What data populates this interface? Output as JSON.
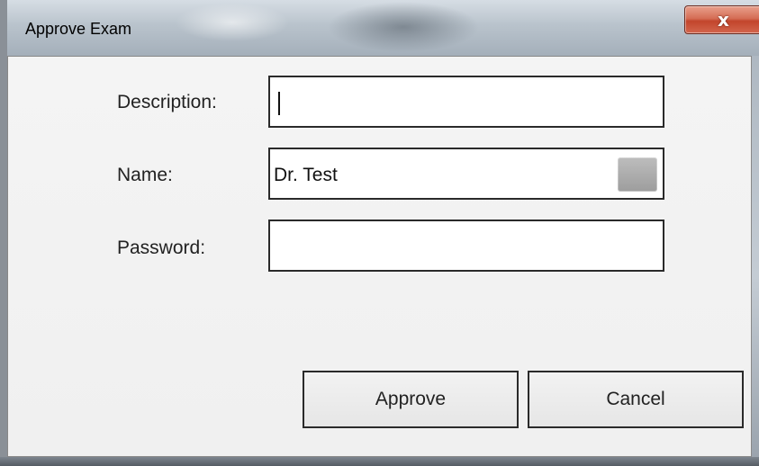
{
  "window": {
    "title": "Approve Exam",
    "close_icon": "close-icon",
    "close_glyph": "x"
  },
  "form": {
    "description": {
      "label": "Description:",
      "value": ""
    },
    "name": {
      "label": "Name:",
      "value": "Dr. Test",
      "picker_icon": "picker-button"
    },
    "password": {
      "label": "Password:",
      "value": ""
    }
  },
  "buttons": {
    "approve_label": "Approve",
    "cancel_label": "Cancel"
  },
  "colors": {
    "close_button": "#c2452c",
    "dialog_background": "#f0f0f0"
  }
}
